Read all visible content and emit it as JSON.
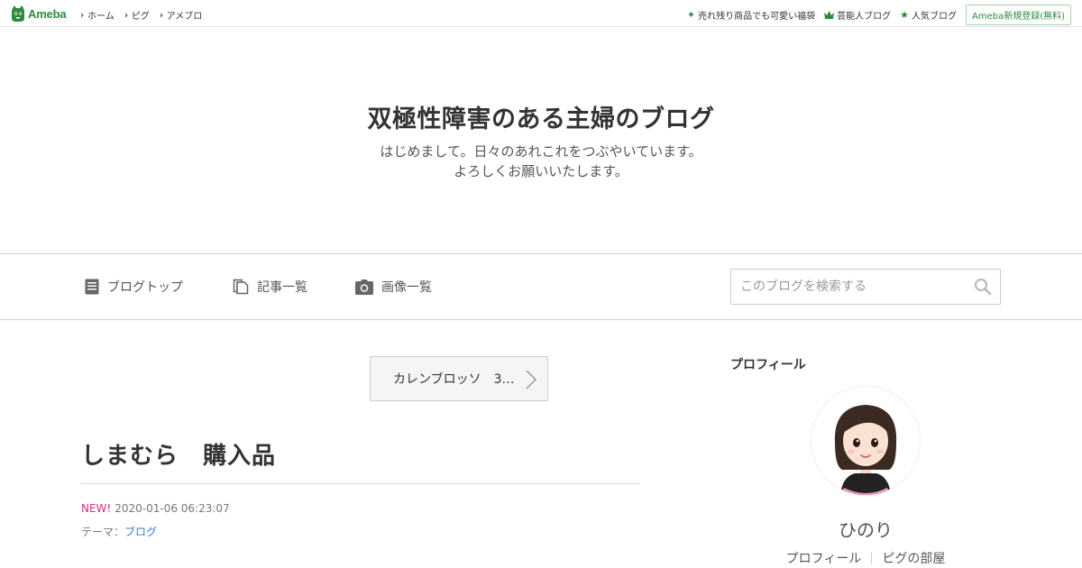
{
  "topbar": {
    "logo_text": "Ameba",
    "nav": [
      "ホーム",
      "ピグ",
      "アメブロ"
    ],
    "links": [
      {
        "icon": "sparkle-icon",
        "label": "売れ残り商品でも可愛い福袋"
      },
      {
        "icon": "crown-icon",
        "label": "芸能人ブログ"
      },
      {
        "icon": "star-icon",
        "label": "人気ブログ"
      }
    ],
    "register_label": "Ameba新規登録(無料)",
    "accent_color": "#2d8c3c"
  },
  "blog": {
    "title": "双極性障害のある主婦のブログ",
    "description_line1": "はじめまして。日々のあれこれをつぶやいています。",
    "description_line2": "よろしくお願いいたします。"
  },
  "navbar": {
    "items": [
      {
        "icon": "document-icon",
        "label": "ブログトップ"
      },
      {
        "icon": "copy-icon",
        "label": "記事一覧"
      },
      {
        "icon": "camera-icon",
        "label": "画像一覧"
      }
    ],
    "search_placeholder": "このブログを検索する"
  },
  "entry": {
    "prev_label": "カレンブロッソ　3…",
    "title": "しまむら　購入品",
    "new_label": "NEW!",
    "datetime": "2020-01-06 06:23:07",
    "theme_prefix": "テーマ：",
    "theme_label": "ブログ"
  },
  "sidebar": {
    "heading": "プロフィール",
    "name": "ひのり",
    "links": [
      "プロフィール",
      "ピグの部屋"
    ]
  }
}
